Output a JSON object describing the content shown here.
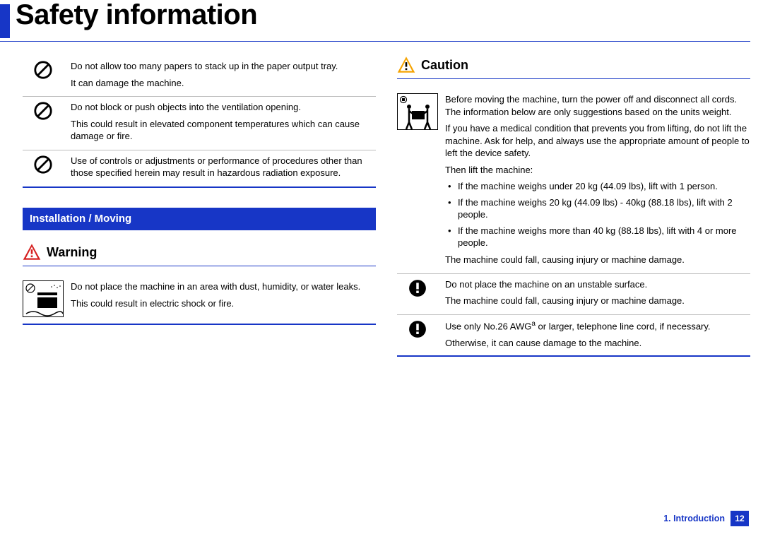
{
  "title": "Safety information",
  "left": {
    "items": [
      {
        "p1": "Do not allow too many papers to stack up in the paper output tray.",
        "p2": "It can damage the machine."
      },
      {
        "p1": "Do not block or push objects into the ventilation opening.",
        "p2": "This could result in elevated component temperatures which can cause damage or fire."
      },
      {
        "p1": "Use of controls or adjustments or performance of procedures other than those specified herein may result in hazardous radiation exposure."
      }
    ],
    "section_bar": "Installation / Moving",
    "warning_label": "Warning",
    "warning_item": {
      "p1": "Do not place the machine in an area with dust, humidity, or water leaks.",
      "p2": "This could result in electric shock or fire."
    }
  },
  "right": {
    "caution_label": "Caution",
    "moving": {
      "p1": "Before moving the machine, turn the power off and disconnect all cords. The information below are only suggestions based on the units weight.",
      "p2": "If you have a medical condition that prevents you from lifting, do not lift the machine. Ask for help, and always use the appropriate amount of people to left the device safety.",
      "p3": "Then lift the machine:",
      "bullets": [
        "If the machine weighs under 20 kg (44.09 lbs), lift with 1 person.",
        "If the machine weighs 20 kg (44.09 lbs) - 40kg (88.18 lbs), lift with 2 people.",
        "If the machine weighs more than 40 kg (88.18 lbs), lift with 4 or more people."
      ],
      "p4": "The machine could fall, causing injury or machine damage."
    },
    "items": [
      {
        "p1": "Do not place the machine on an unstable surface.",
        "p2": "The machine could fall, causing injury or machine damage."
      },
      {
        "p1_html": "Use only No.26 AWG<sup>a</sup> or larger, telephone line cord, if necessary.",
        "p2": "Otherwise, it can cause damage to the machine."
      }
    ]
  },
  "footer": {
    "chapter": "1. Introduction",
    "page": "12"
  }
}
